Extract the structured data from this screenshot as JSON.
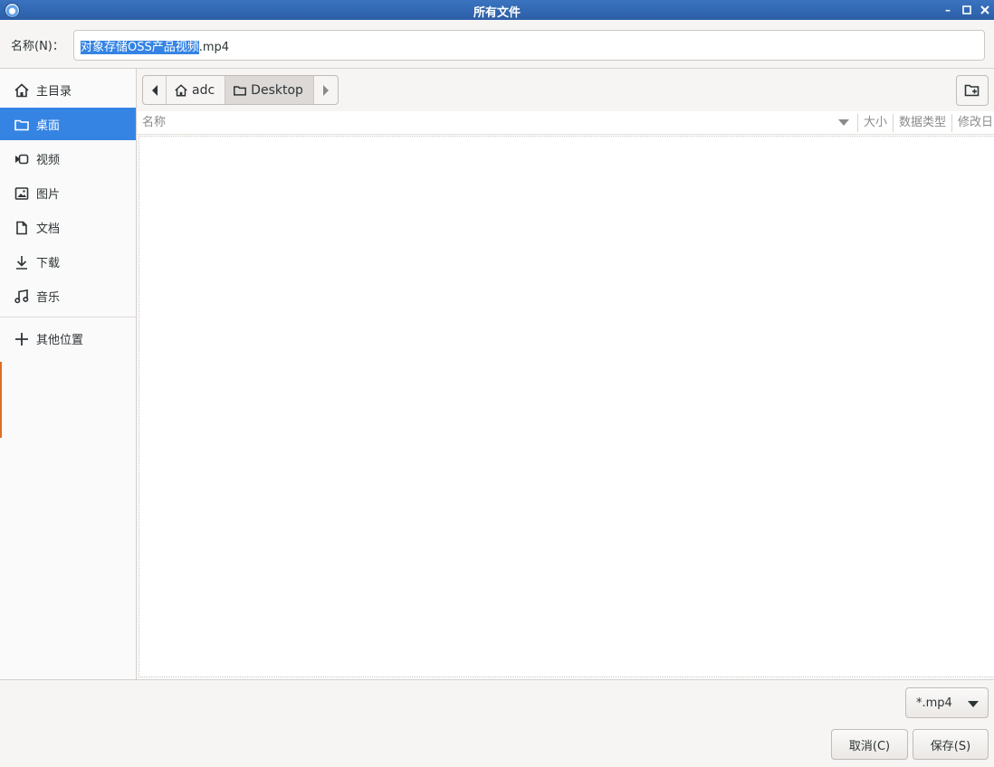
{
  "window": {
    "title": "所有文件"
  },
  "name_row": {
    "label": "名称(N)：",
    "value_selected": "对象存储OSS产品视频",
    "value_rest": ".mp4"
  },
  "sidebar": {
    "items": [
      {
        "label": "主目录",
        "icon": "home-icon"
      },
      {
        "label": "桌面",
        "icon": "folder-icon",
        "active": true
      },
      {
        "label": "视频",
        "icon": "video-icon"
      },
      {
        "label": "图片",
        "icon": "image-icon"
      },
      {
        "label": "文档",
        "icon": "document-icon"
      },
      {
        "label": "下载",
        "icon": "download-icon"
      },
      {
        "label": "音乐",
        "icon": "music-icon"
      }
    ],
    "other_locations": {
      "label": "其他位置",
      "icon": "plus-icon"
    }
  },
  "pathbar": {
    "segments": [
      {
        "label": "adc",
        "icon": "home-icon"
      },
      {
        "label": "Desktop",
        "icon": "folder-icon",
        "current": true
      }
    ]
  },
  "columns": {
    "name": "名称",
    "size": "大小",
    "type": "数据类型",
    "modified": "修改日"
  },
  "files": [],
  "filter": {
    "selected": "*.mp4"
  },
  "buttons": {
    "cancel": "取消(C)",
    "save": "保存(S)"
  },
  "colors": {
    "accent": "#3584e4",
    "titlebar": "#2c5ea6"
  }
}
